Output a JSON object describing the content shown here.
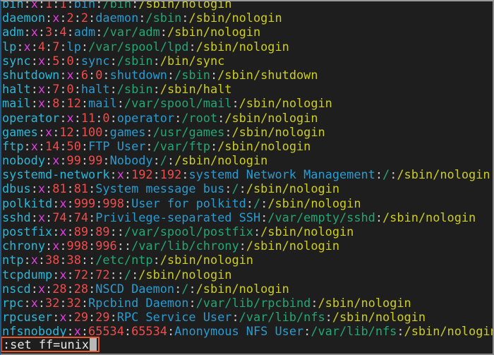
{
  "app": "vim",
  "file_content": "/etc/passwd",
  "colors": {
    "background": "#1e1e1e",
    "username": "#29b8db",
    "password": "#e040e0",
    "ids": "#f14c4c",
    "gecos": "#2a9bd0",
    "home": "#23a775",
    "shell": "#cdcd22",
    "separator": "#cccccc",
    "highlight_box": "#e8562a"
  },
  "lines": [
    {
      "user": "bin",
      "pw": "x",
      "uid": "1",
      "gid": "1",
      "gecos": "bin",
      "home": "/bin",
      "shell": "/sbin/nologin"
    },
    {
      "user": "daemon",
      "pw": "x",
      "uid": "2",
      "gid": "2",
      "gecos": "daemon",
      "home": "/sbin",
      "shell": "/sbin/nologin"
    },
    {
      "user": "adm",
      "pw": "x",
      "uid": "3",
      "gid": "4",
      "gecos": "adm",
      "home": "/var/adm",
      "shell": "/sbin/nologin"
    },
    {
      "user": "lp",
      "pw": "x",
      "uid": "4",
      "gid": "7",
      "gecos": "lp",
      "home": "/var/spool/lpd",
      "shell": "/sbin/nologin"
    },
    {
      "user": "sync",
      "pw": "x",
      "uid": "5",
      "gid": "0",
      "gecos": "sync",
      "home": "/sbin",
      "shell": "/bin/sync"
    },
    {
      "user": "shutdown",
      "pw": "x",
      "uid": "6",
      "gid": "0",
      "gecos": "shutdown",
      "home": "/sbin",
      "shell": "/sbin/shutdown"
    },
    {
      "user": "halt",
      "pw": "x",
      "uid": "7",
      "gid": "0",
      "gecos": "halt",
      "home": "/sbin",
      "shell": "/sbin/halt"
    },
    {
      "user": "mail",
      "pw": "x",
      "uid": "8",
      "gid": "12",
      "gecos": "mail",
      "home": "/var/spool/mail",
      "shell": "/sbin/nologin"
    },
    {
      "user": "operator",
      "pw": "x",
      "uid": "11",
      "gid": "0",
      "gecos": "operator",
      "home": "/root",
      "shell": "/sbin/nologin"
    },
    {
      "user": "games",
      "pw": "x",
      "uid": "12",
      "gid": "100",
      "gecos": "games",
      "home": "/usr/games",
      "shell": "/sbin/nologin"
    },
    {
      "user": "ftp",
      "pw": "x",
      "uid": "14",
      "gid": "50",
      "gecos": "FTP User",
      "home": "/var/ftp",
      "shell": "/sbin/nologin"
    },
    {
      "user": "nobody",
      "pw": "x",
      "uid": "99",
      "gid": "99",
      "gecos": "Nobody",
      "home": "/",
      "shell": "/sbin/nologin"
    },
    {
      "user": "systemd-network",
      "pw": "x",
      "uid": "192",
      "gid": "192",
      "gecos": "systemd Network Management",
      "home": "/",
      "shell": "/sbin/nologin"
    },
    {
      "user": "dbus",
      "pw": "x",
      "uid": "81",
      "gid": "81",
      "gecos": "System message bus",
      "home": "/",
      "shell": "/sbin/nologin"
    },
    {
      "user": "polkitd",
      "pw": "x",
      "uid": "999",
      "gid": "998",
      "gecos": "User for polkitd",
      "home": "/",
      "shell": "/sbin/nologin"
    },
    {
      "user": "sshd",
      "pw": "x",
      "uid": "74",
      "gid": "74",
      "gecos": "Privilege-separated SSH",
      "home": "/var/empty/sshd",
      "shell": "/sbin/nologin"
    },
    {
      "user": "postfix",
      "pw": "x",
      "uid": "89",
      "gid": "89",
      "gecos": "",
      "home": "/var/spool/postfix",
      "shell": "/sbin/nologin"
    },
    {
      "user": "chrony",
      "pw": "x",
      "uid": "998",
      "gid": "996",
      "gecos": "",
      "home": "/var/lib/chrony",
      "shell": "/sbin/nologin"
    },
    {
      "user": "ntp",
      "pw": "x",
      "uid": "38",
      "gid": "38",
      "gecos": "",
      "home": "/etc/ntp",
      "shell": "/sbin/nologin"
    },
    {
      "user": "tcpdump",
      "pw": "x",
      "uid": "72",
      "gid": "72",
      "gecos": "",
      "home": "/",
      "shell": "/sbin/nologin"
    },
    {
      "user": "nscd",
      "pw": "x",
      "uid": "28",
      "gid": "28",
      "gecos": "NSCD Daemon",
      "home": "/",
      "shell": "/sbin/nologin"
    },
    {
      "user": "rpc",
      "pw": "x",
      "uid": "32",
      "gid": "32",
      "gecos": "Rpcbind Daemon",
      "home": "/var/lib/rpcbind",
      "shell": "/sbin/nologin"
    },
    {
      "user": "rpcuser",
      "pw": "x",
      "uid": "29",
      "gid": "29",
      "gecos": "RPC Service User",
      "home": "/var/lib/nfs",
      "shell": "/sbin/nologin"
    },
    {
      "user": "nfsnobody",
      "pw": "x",
      "uid": "65534",
      "gid": "65534",
      "gecos": "Anonymous NFS User",
      "home": "/var/lib/nfs",
      "shell": "/sbin/nologin"
    }
  ],
  "command_line": {
    "text": ":set ff=unix"
  }
}
